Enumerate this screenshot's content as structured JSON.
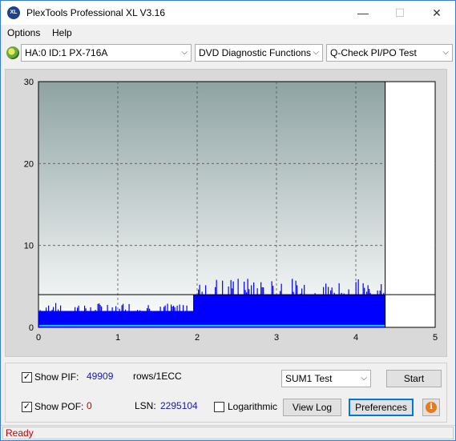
{
  "window": {
    "title": "PlexTools Professional XL V3.16",
    "icon_text": "XL"
  },
  "menu": {
    "options": "Options",
    "help": "Help"
  },
  "toolbar": {
    "drive": "HA:0 ID:1  PX-716A",
    "function": "DVD Diagnostic Functions",
    "test": "Q-Check PI/PO Test"
  },
  "chart_data": {
    "type": "bar",
    "title": "",
    "xlabel": "",
    "ylabel": "",
    "xlim": [
      0,
      5
    ],
    "ylim": [
      0,
      30
    ],
    "x_ticks": [
      "0",
      "1",
      "2",
      "3",
      "4",
      "5"
    ],
    "y_ticks": [
      "0",
      "10",
      "20",
      "30"
    ],
    "grid": true,
    "threshold_line": 4,
    "end_marker_x": 4.37,
    "series": [
      {
        "name": "PIF",
        "color": "#0000ff",
        "segments": [
          {
            "x_start": 0.0,
            "x_end": 1.95,
            "typical": 2,
            "peak": 3
          },
          {
            "x_start": 1.95,
            "x_end": 4.37,
            "typical": 4,
            "peak": 6
          }
        ]
      },
      {
        "name": "POF",
        "color": "#00c8ff",
        "baseline": 0.2
      }
    ],
    "plot_background": {
      "top": "#8fa3a3",
      "bottom": "#ffffff"
    }
  },
  "controls": {
    "show_pif_label": "Show PIF:",
    "pif_value": "49909",
    "pif_unit": "rows/1ECC",
    "show_pof_label": "Show POF:",
    "pof_value": "0",
    "lsn_label": "LSN:",
    "lsn_value": "2295104",
    "logarithmic_label": "Logarithmic",
    "sum_select": "SUM1 Test",
    "start_button": "Start",
    "view_log_button": "View Log",
    "preferences_button": "Preferences",
    "info_icon": "i"
  },
  "status": {
    "text": "Ready"
  }
}
